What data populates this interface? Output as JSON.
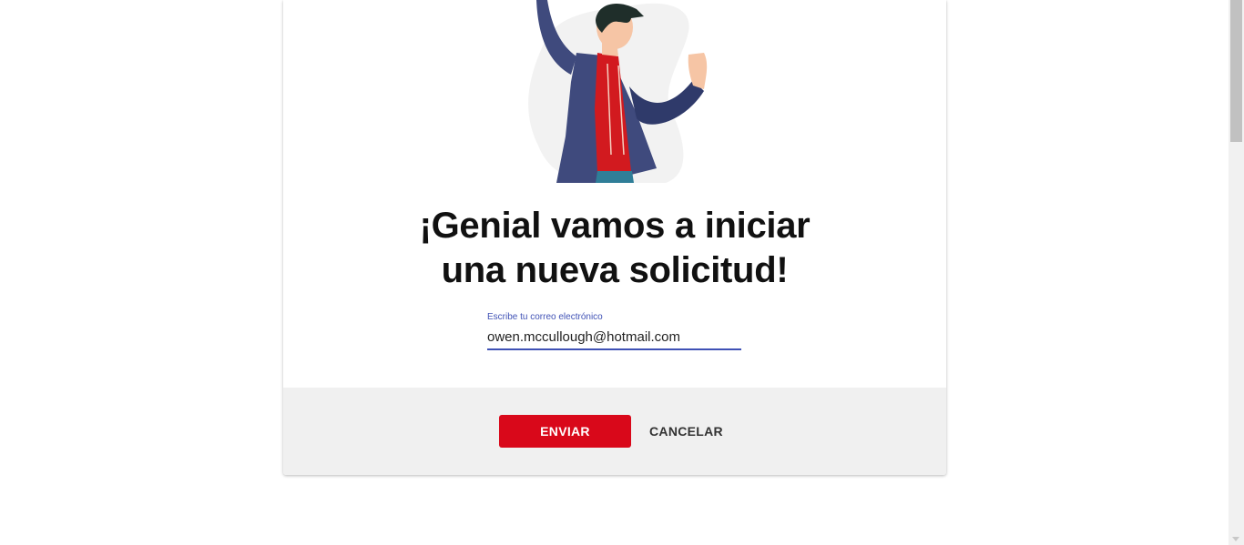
{
  "heading": {
    "line1": "¡Genial vamos a iniciar",
    "line2": "una nueva solicitud!"
  },
  "email_field": {
    "label": "Escribe tu correo electrónico",
    "value": "owen.mccullough@hotmail.com"
  },
  "actions": {
    "submit_label": "ENVIAR",
    "cancel_label": "CANCELAR"
  },
  "colors": {
    "primary": "#d9081a",
    "accent": "#3f51b5",
    "footer_bg": "#f0f0f0"
  },
  "icons": {
    "illustration": "celebrating-person-illustration"
  }
}
